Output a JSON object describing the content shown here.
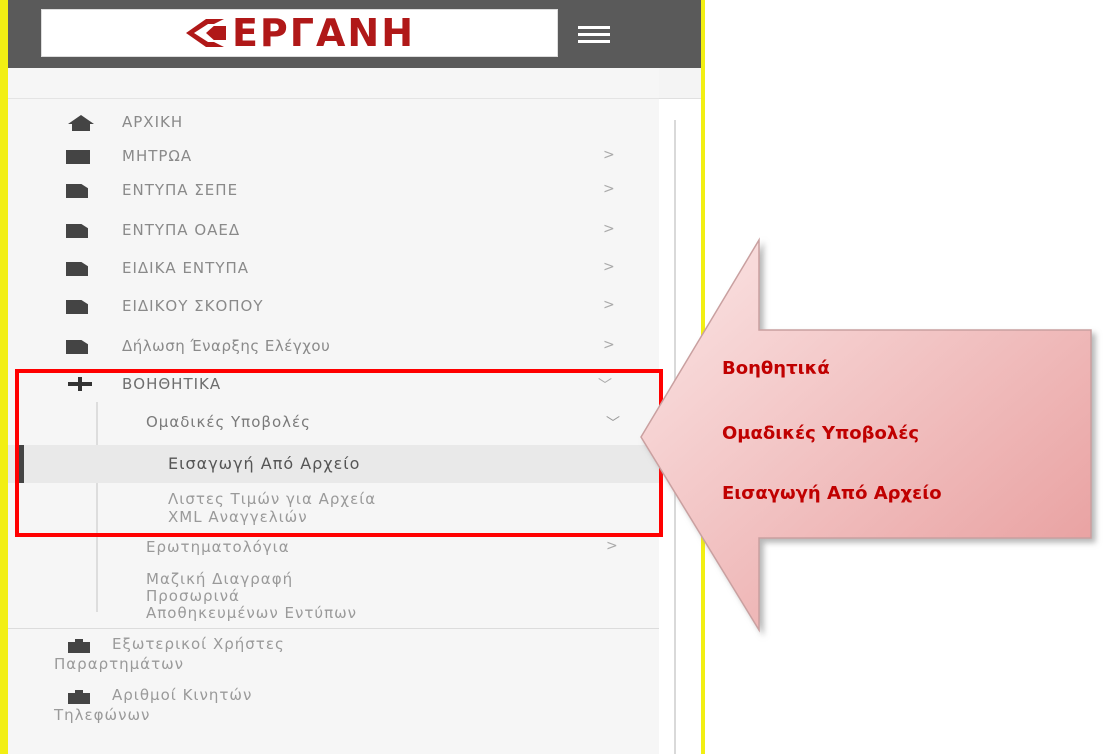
{
  "header": {
    "logo_text": "ΕΡΓΑΝΗ"
  },
  "sidebar": {
    "items": [
      {
        "label": "ΑΡΧΙΚΗ",
        "icon": "home-icon",
        "arrow": ""
      },
      {
        "label": "ΜΗΤΡΩΑ",
        "icon": "book-icon",
        "arrow": ">"
      },
      {
        "label": "ΕΝΤΥΠΑ ΣΕΠΕ",
        "icon": "file-icon",
        "arrow": ">"
      },
      {
        "label": "ΕΝΤΥΠΑ ΟΑΕΔ",
        "icon": "file-icon",
        "arrow": ">"
      },
      {
        "label": "ΕΙΔΙΚΑ ΕΝΤΥΠΑ",
        "icon": "file-icon",
        "arrow": ">"
      },
      {
        "label": "ΕΙΔΙΚΟΥ ΣΚΟΠΟΥ",
        "icon": "file-icon",
        "arrow": ">"
      },
      {
        "label": "Δήλωση Έναρξης Ελέγχου",
        "icon": "file-icon",
        "arrow": ">"
      },
      {
        "label": "ΒΟΗΘΗΤΙΚΑ",
        "icon": "plus-icon",
        "arrow": "﹀"
      }
    ],
    "submenu": {
      "group_label": "Ομαδικές Υποβολές",
      "group_arrow": "﹀",
      "active_item": "Εισαγωγή Από Αρχείο",
      "item_lists_line1": "Λιστες Τιμών για Αρχεία",
      "item_lists_line2": "XML Αναγγελιών",
      "item_questionnaires": "Ερωτηματολόγια",
      "item_questionnaires_arrow": ">",
      "item_mass_delete_line1": "Μαζική Διαγραφή",
      "item_mass_delete_line2": "Προσωρινά",
      "item_mass_delete_line3": "Αποθηκευμένων Εντύπων"
    },
    "bottom_items": [
      {
        "line1": "Εξωτερικοί Χρήστες",
        "line2": "Παραρτημάτων",
        "icon": "briefcase-icon"
      },
      {
        "line1": "Αριθμοί Κινητών",
        "line2": "Τηλεφώνων",
        "icon": "briefcase-icon"
      }
    ]
  },
  "callout": {
    "line1": "Βοηθητικά",
    "line2": "Ομαδικές Υποβολές",
    "line3": "Εισαγωγή Από Αρχείο"
  },
  "colors": {
    "highlight_border": "#ff0000",
    "callout_text": "#c00000",
    "callout_fill": "#f4c8c8",
    "topbar": "#5a5a5a",
    "logo": "#b01818",
    "side_edge": "#f2ef13"
  }
}
